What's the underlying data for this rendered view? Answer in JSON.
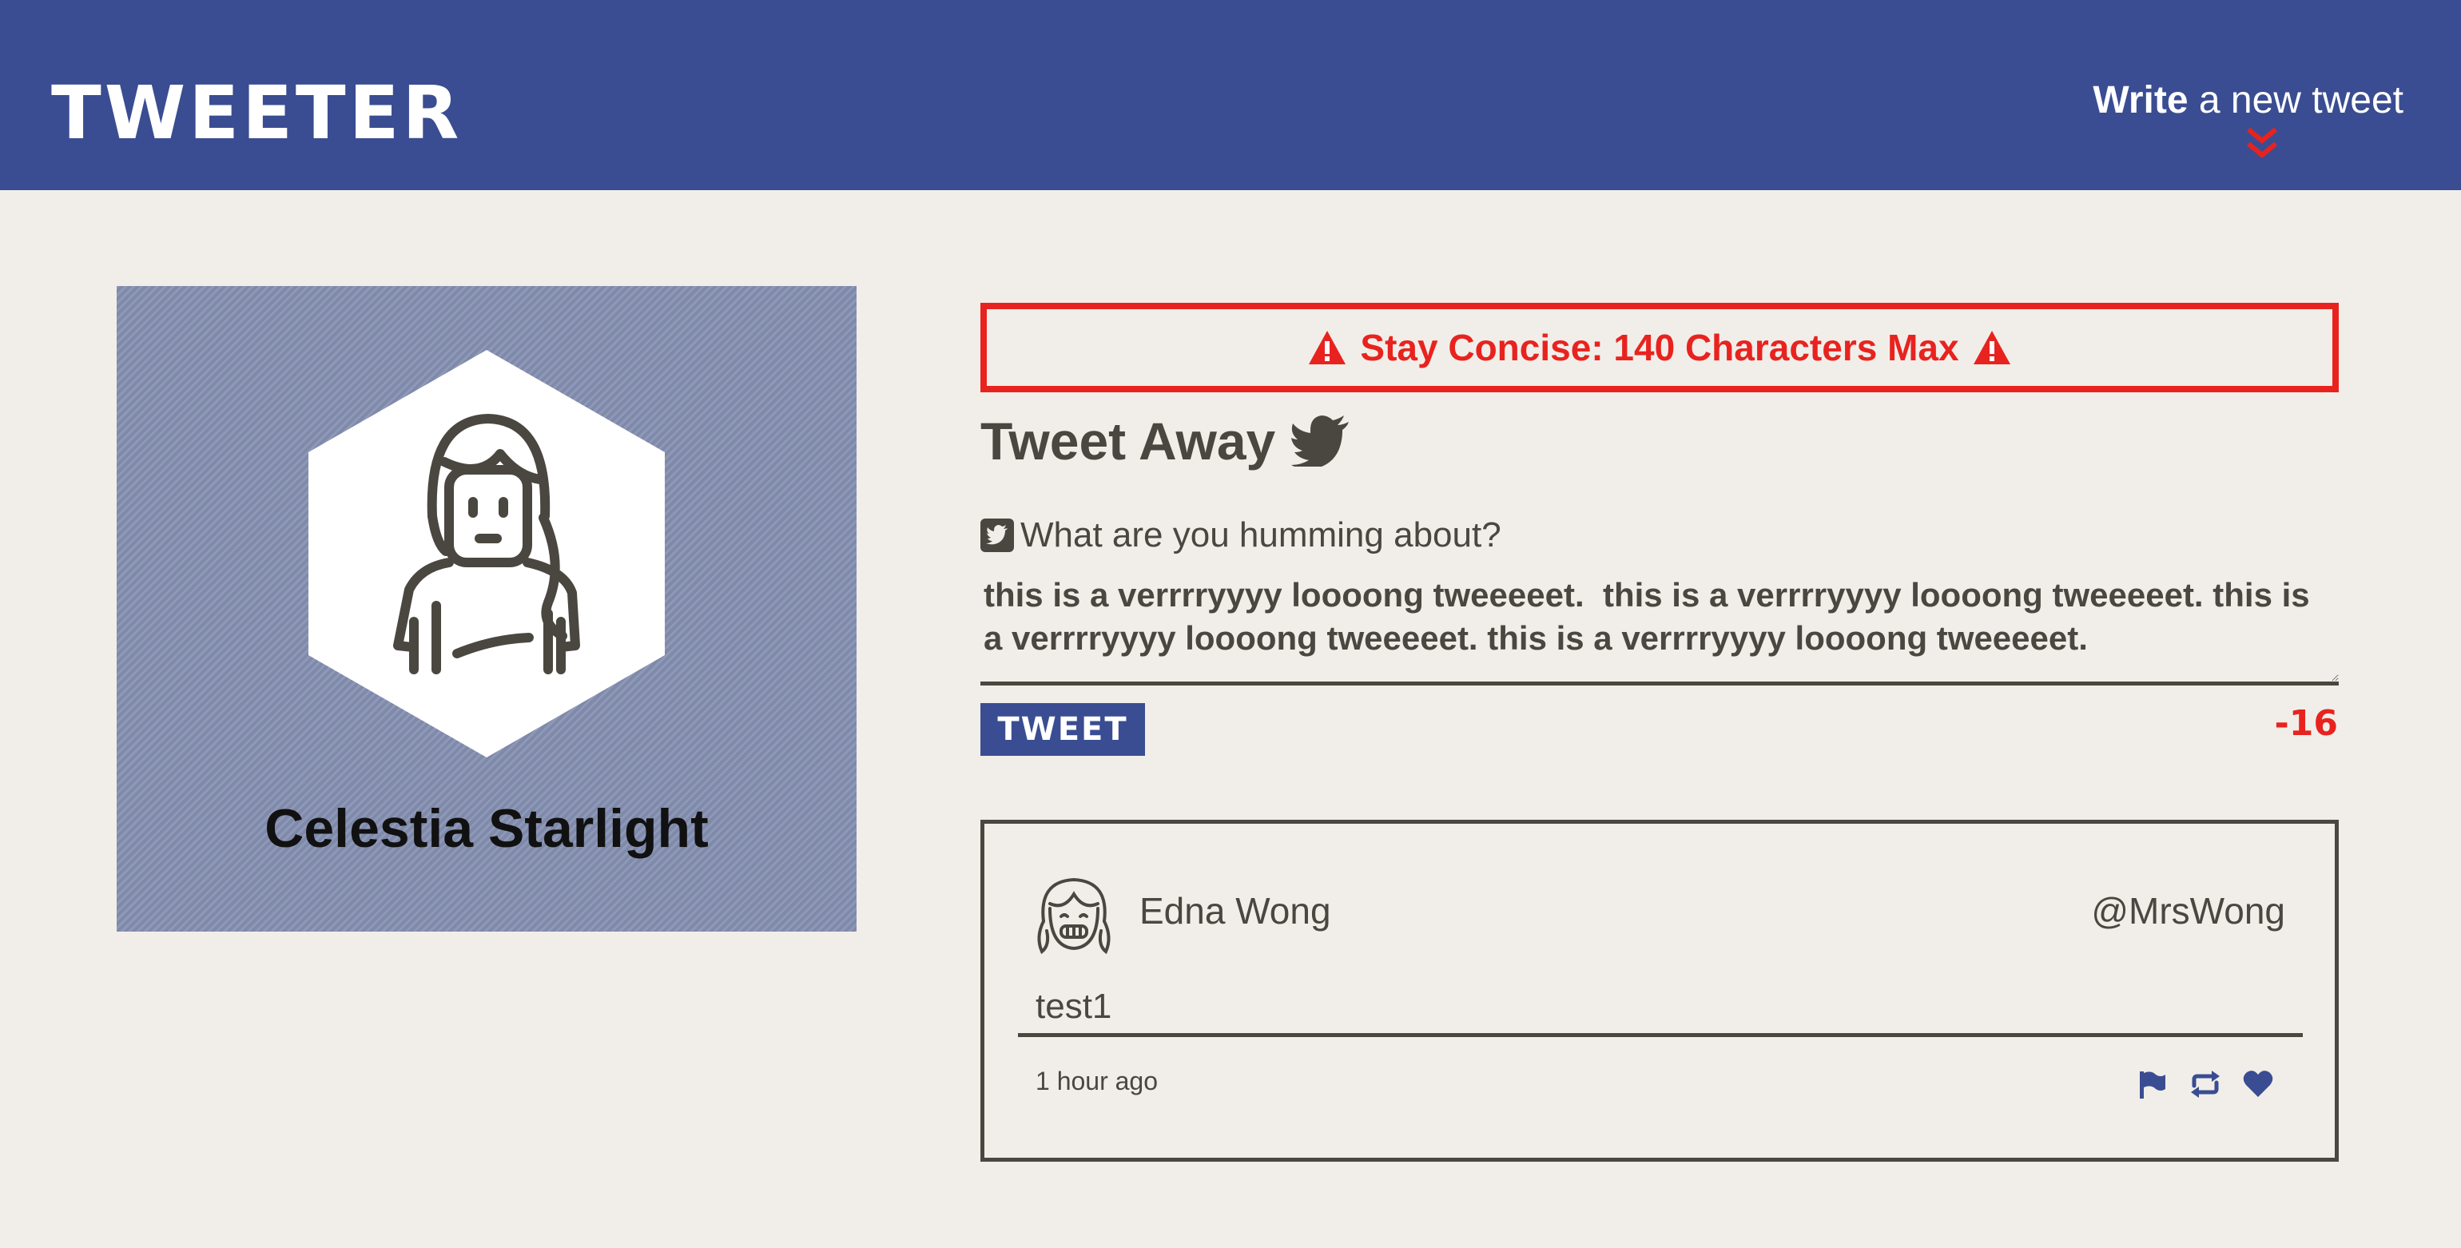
{
  "nav": {
    "brand": "TWEETER",
    "compose_bold": "Write",
    "compose_rest": " a new tweet",
    "compose_icon": "chevron-double-down-icon"
  },
  "profile": {
    "name": "Celestia Starlight",
    "avatar_icon": "girl-avatar-icon"
  },
  "composer": {
    "alert_text": "Stay Concise: 140 Characters Max",
    "alert_icon": "warning-icon",
    "title": "Tweet Away",
    "title_icon": "twitter-bird-icon",
    "label": "What are you humming about?",
    "label_icon": "twitter-square-icon",
    "input_value": "this is a verrrryyyy loooong tweeeeet.  this is a verrrryyyy loooong tweeeeet. this is a verrrryyyy loooong tweeeeet. this is a verrrryyyy loooong tweeeeet.",
    "button_label": "TWEET",
    "counter": "-16"
  },
  "tweets": [
    {
      "author": "Edna Wong",
      "handle": "@MrsWong",
      "text": "test1",
      "time": "1 hour ago",
      "actions": [
        "flag-icon",
        "retweet-icon",
        "heart-icon"
      ]
    }
  ],
  "colors": {
    "nav_bg": "#3a4d92",
    "page_bg": "#f1eee9",
    "alert_red": "#e8231f",
    "text": "#4a4740",
    "profile_bg": "#8690b2"
  }
}
